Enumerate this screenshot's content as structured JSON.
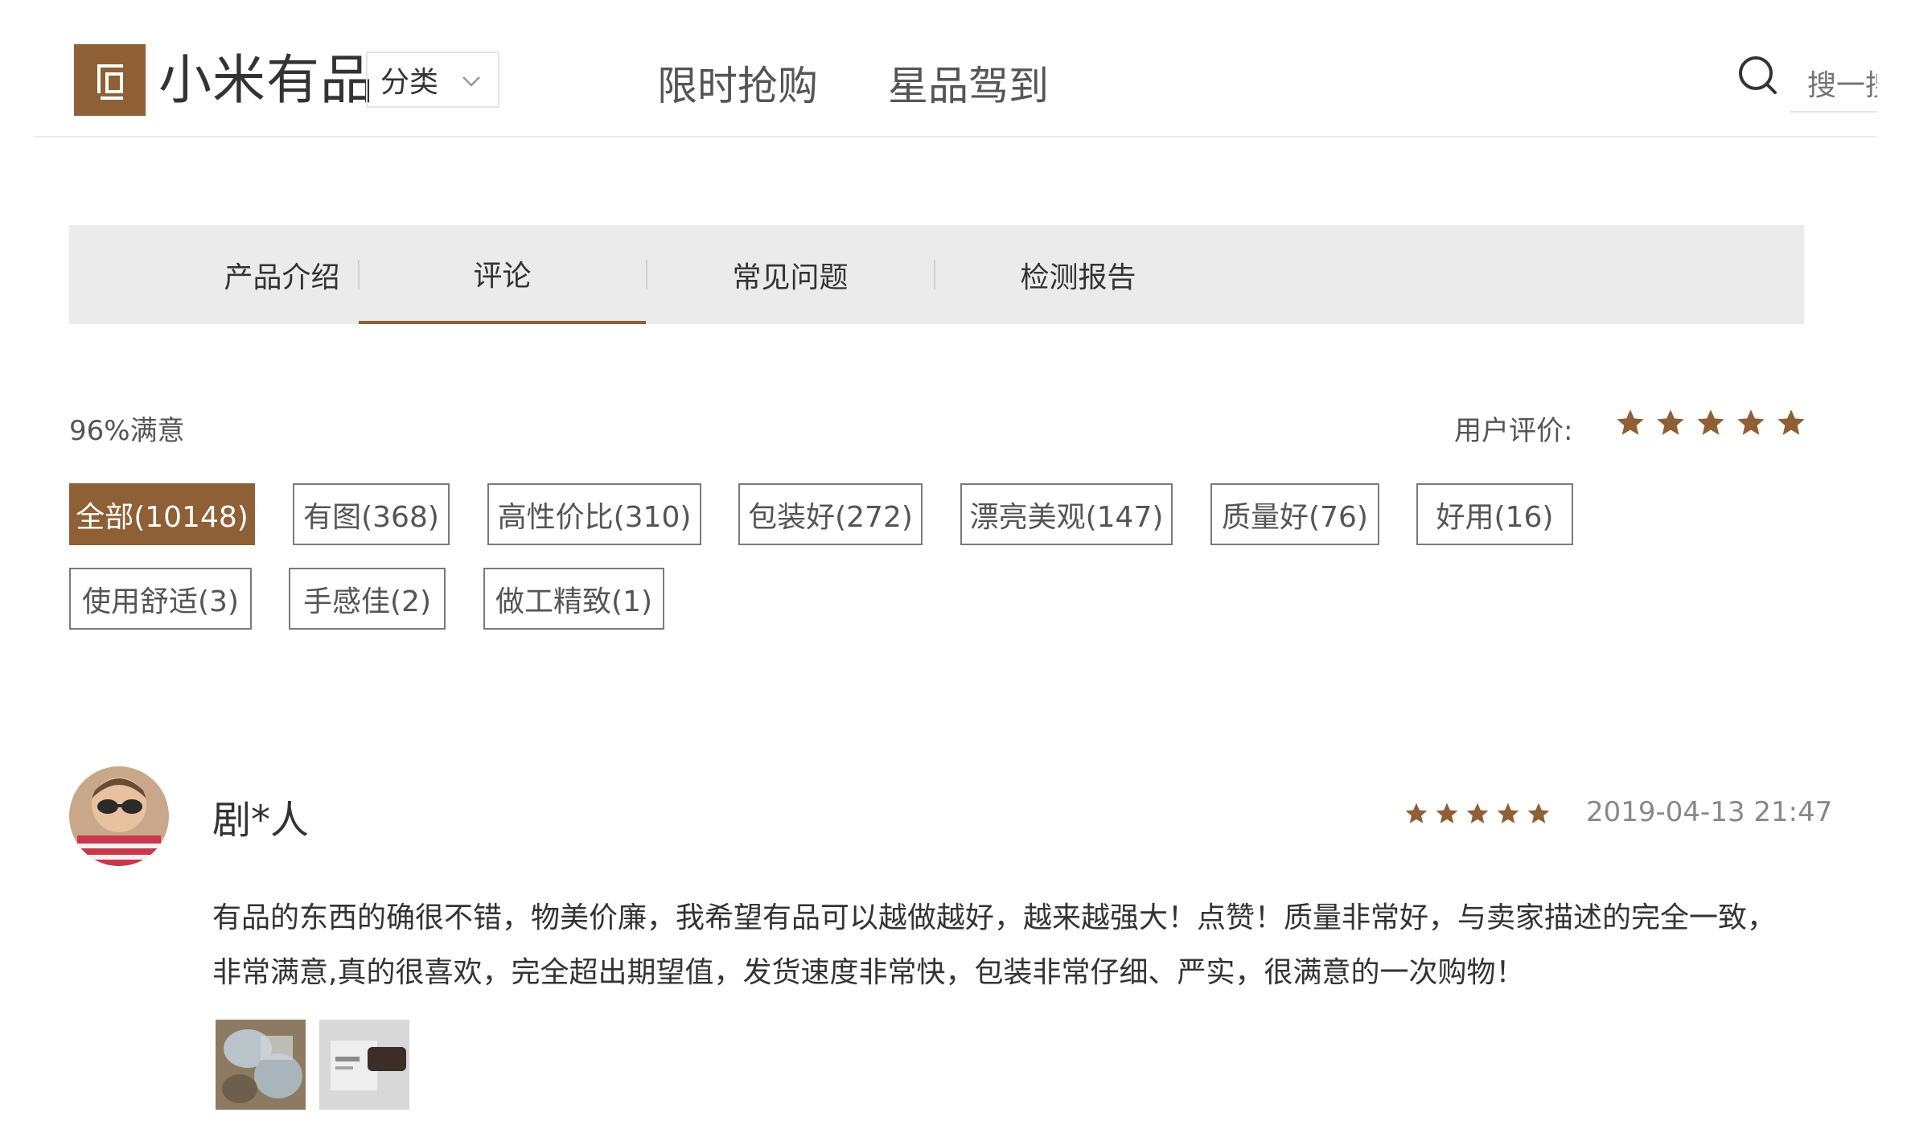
{
  "header": {
    "brand": "小米有品",
    "category_label": "分类",
    "nav": [
      "限时抢购",
      "星品驾到"
    ],
    "search_placeholder": "搜一搜"
  },
  "tabs": [
    {
      "label": "产品介绍",
      "active": false
    },
    {
      "label": "评论",
      "active": true
    },
    {
      "label": "常见问题",
      "active": false
    },
    {
      "label": "检测报告",
      "active": false
    }
  ],
  "summary": {
    "satisfaction": "96%满意",
    "user_rating_label": "用户评价:",
    "user_rating_stars": 5
  },
  "filters": [
    {
      "label": "全部(10148)",
      "active": true
    },
    {
      "label": "有图(368)",
      "active": false
    },
    {
      "label": "高性价比(310)",
      "active": false
    },
    {
      "label": "包装好(272)",
      "active": false
    },
    {
      "label": "漂亮美观(147)",
      "active": false
    },
    {
      "label": "质量好(76)",
      "active": false
    },
    {
      "label": "好用(16)",
      "active": false
    },
    {
      "label": "使用舒适(3)",
      "active": false
    },
    {
      "label": "手感佳(2)",
      "active": false
    },
    {
      "label": "做工精致(1)",
      "active": false
    }
  ],
  "review": {
    "user": "剧*人",
    "stars": 5,
    "date": "2019-04-13 21:47",
    "content": "有品的东西的确很不错，物美价廉，我希望有品可以越做越好，越来越强大！点赞！质量非常好，与卖家描述的完全一致，非常满意,真的很喜欢，完全超出期望值，发货速度非常快，包装非常仔细、严实，很满意的一次购物！"
  },
  "colors": {
    "brand": "#8f5f35",
    "tab_bar": "#ebebeb",
    "text": "#333333",
    "muted": "#888888"
  }
}
